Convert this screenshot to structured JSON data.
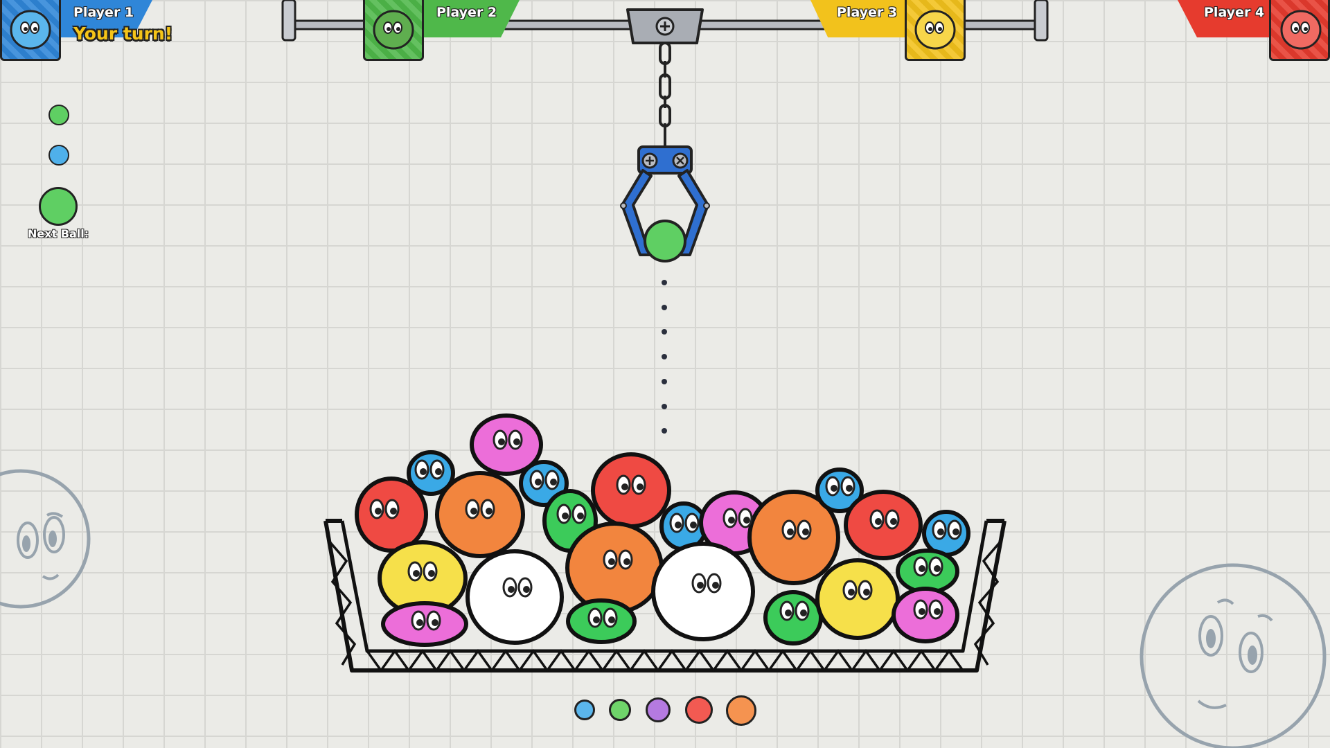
{
  "players": [
    {
      "label": "Player 1",
      "color": "#2f86d8",
      "turn_text": "Your turn!"
    },
    {
      "label": "Player 2",
      "color": "#4fb84a"
    },
    {
      "label": "Player 3",
      "color": "#f2c21c"
    },
    {
      "label": "Player 4",
      "color": "#e63b2e"
    }
  ],
  "next_ball": {
    "label": "Next Ball:",
    "color": "#5fcf63",
    "queue": [
      "#5fcf63",
      "#4fb0ea"
    ]
  },
  "claw": {
    "held_ball_color": "#5fcf63"
  },
  "palette": [
    "#5bb6ec",
    "#6fd46a",
    "#b57ae0",
    "#f25a52",
    "#f59350"
  ],
  "icons": {
    "rail_mount": "plus-screw-icon",
    "claw": "claw-icon"
  }
}
